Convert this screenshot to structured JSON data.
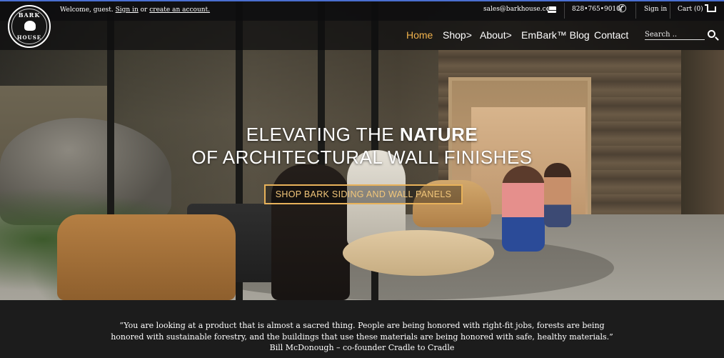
{
  "topbar": {
    "welcome_prefix": "Welcome, guest.",
    "sign_in_link": "Sign in",
    "or_text": "or",
    "create_account_link": "create an account.",
    "email": "sales@barkhouse.com",
    "phone": "828•765•9010",
    "sign_in": "Sign in",
    "cart": "Cart (0)"
  },
  "logo": {
    "top": "BARK",
    "bottom": "HOUSE"
  },
  "nav": {
    "items": [
      "Home",
      "Shop>",
      "About>",
      "EmBark™ Blog",
      "Contact"
    ],
    "search_placeholder": "Search .."
  },
  "hero": {
    "line1_prefix": "ELEVATING THE ",
    "line1_bold": "NATURE",
    "line2": "OF ARCHITECTURAL WALL FINISHES",
    "cta": "SHOP BARK SIDING AND WALL PANELS"
  },
  "quote": {
    "line1": "“You are looking at a product that is almost a sacred thing. People are being honored with right-fit jobs, forests are being",
    "line2": "honored with sustainable forestry, and the buildings that use these materials are being honored with safe, healthy materials.”",
    "attribution": "Bill McDonough – co-founder Cradle to Cradle"
  },
  "colors": {
    "accent": "#f0b24c",
    "cta_border": "#e8b25a",
    "topbar_border": "#4a6fd1"
  }
}
